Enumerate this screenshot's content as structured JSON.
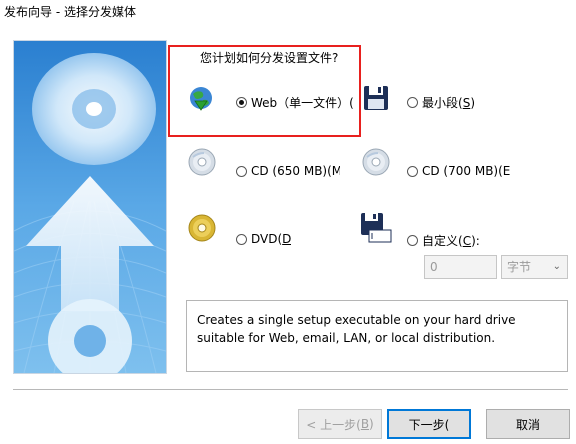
{
  "window": {
    "title": "发布向导 - 选择分发媒体"
  },
  "question": "您计划如何分发设置文件?",
  "options": {
    "web": {
      "label": "Web（单一文件）(",
      "selected": true
    },
    "min_seg": {
      "label_main": "最小段(",
      "label_key": "S",
      "label_end": ")"
    },
    "cd650": {
      "label": "CD (650 MB)(M"
    },
    "cd700": {
      "label": "CD (700 MB)(E"
    },
    "dvd": {
      "label_main": "DVD(",
      "label_key": "D"
    },
    "custom": {
      "label_main": "自定义(",
      "label_key": "C",
      "label_end": "):"
    }
  },
  "custom_size": {
    "value": "0",
    "unit": "字节"
  },
  "description": "Creates a single setup executable on your hard drive suitable for Web, email, LAN, or local distribution.",
  "buttons": {
    "back": {
      "label_main": "< 上一步(",
      "label_key": "B",
      "label_end": ")"
    },
    "next": "下一步(",
    "cancel": "取消"
  },
  "icons": [
    "web-globe-icon",
    "floppy-disk-icon",
    "cd-icon",
    "cd-icon",
    "dvd-icon",
    "floppy-custom-icon",
    "chevron-down-icon"
  ]
}
